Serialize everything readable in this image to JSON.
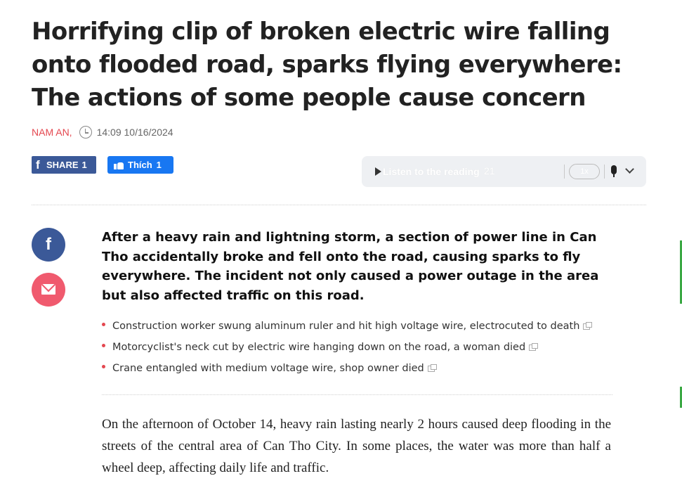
{
  "article": {
    "title": "Horrifying clip of broken electric wire falling onto flooded road, sparks flying everywhere: The actions of some people cause concern",
    "author": "NAM AN,",
    "timestamp": "14:09 10/16/2024",
    "sapo": "After a heavy rain and lightning storm, a section of power line in Can Tho accidentally broke and fell onto the road, causing sparks to fly everywhere. The incident not only caused a power outage in the area but also affected traffic on this road.",
    "body": "On the afternoon of October 14, heavy rain lasting nearly 2 hours caused deep flooding in the streets of the central area of Can Tho City. In some places, the water was more than half a wheel deep, affecting daily life and traffic."
  },
  "social": {
    "fb_share_label": "SHARE",
    "fb_share_count": "1",
    "like_label": "Thích",
    "like_count": "1"
  },
  "audio": {
    "label": "Listen to the reading",
    "duration": "21",
    "speed": "1x"
  },
  "related": [
    "Construction worker swung aluminum ruler and hit high voltage wire, electrocuted to death",
    "Motorcyclist's neck cut by electric wire hanging down on the road, a woman died",
    "Crane entangled with medium voltage wire, shop owner died"
  ],
  "colors": {
    "author": "#e4474f",
    "facebook": "#3b5998",
    "like": "#1877f2",
    "mail": "#f05a6e"
  }
}
